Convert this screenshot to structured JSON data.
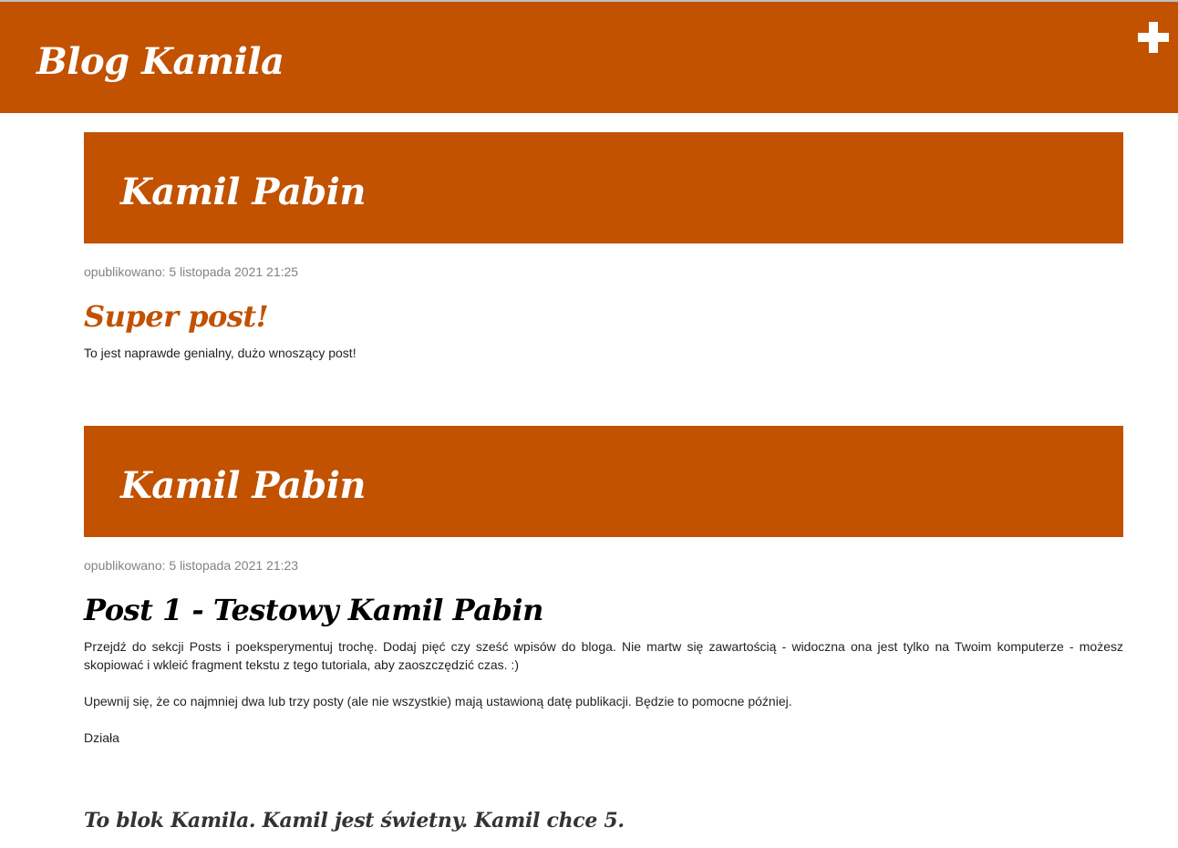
{
  "header": {
    "site_title": "Blog Kamila",
    "add_icon": "plus-icon",
    "accent_color": "#c25100"
  },
  "posts": [
    {
      "author": "Kamil Pabin",
      "date": "opublikowano: 5 listopada 2021 21:25",
      "title": "Super post!",
      "paragraphs": [
        "To jest naprawde genialny, dużo wnoszący post!"
      ]
    },
    {
      "author": "Kamil Pabin",
      "date": "opublikowano: 5 listopada 2021 21:23",
      "title": "Post 1 - Testowy Kamil Pabin",
      "paragraphs": [
        "Przejdź do sekcji Posts i poeksperymentuj trochę. Dodaj pięć czy sześć wpisów do bloga. Nie martw się zawartością - widoczna ona jest tylko na Twoim komputerze - możesz skopiować i wkleić fragment tekstu z tego tutoriala, aby zaoszczędzić czas. :)",
        "Upewnij się, że co najmniej dwa lub trzy posty (ale nie wszystkie) mają ustawioną datę publikacji. Będzie to pomocne później.",
        "Działa"
      ]
    }
  ],
  "footer": {
    "text": "To blok Kamila. Kamil jest świetny. Kamil chce 5."
  }
}
